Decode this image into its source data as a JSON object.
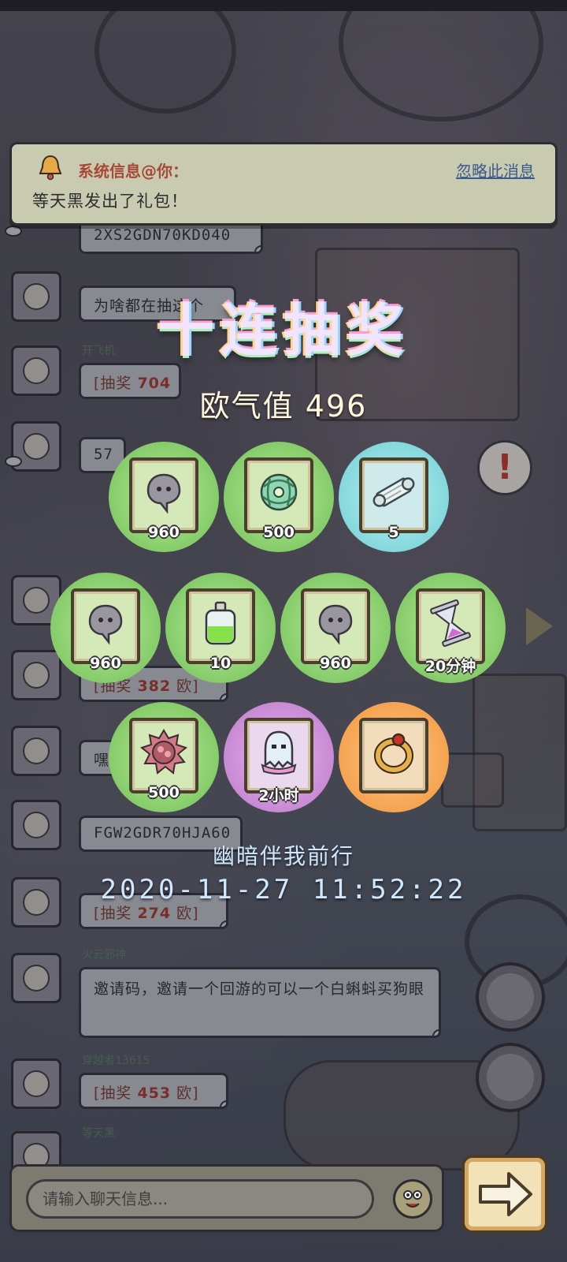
{
  "system_message": {
    "title": "系统信息@你：",
    "ignore_label": "忽略此消息",
    "body": "等天黑发出了礼包！"
  },
  "lottery": {
    "title": "十连抽奖",
    "luck_label": "欧气值",
    "luck_value": "496",
    "prizes": [
      {
        "quantity": "960",
        "rarity": "green",
        "icon": "ghost-blob-icon"
      },
      {
        "quantity": "500",
        "rarity": "green",
        "icon": "green-orb-icon"
      },
      {
        "quantity": "5",
        "rarity": "cyan",
        "icon": "scroll-icon"
      },
      {
        "quantity": "960",
        "rarity": "green",
        "icon": "ghost-blob-icon"
      },
      {
        "quantity": "10",
        "rarity": "green",
        "icon": "potion-bottle-icon"
      },
      {
        "quantity": "960",
        "rarity": "green",
        "icon": "ghost-blob-icon"
      },
      {
        "quantity": "20分钟",
        "rarity": "green",
        "icon": "hourglass-icon"
      },
      {
        "quantity": "500",
        "rarity": "green",
        "icon": "spiked-shell-icon"
      },
      {
        "quantity": "2小时",
        "rarity": "purple",
        "icon": "ghost-costume-icon"
      },
      {
        "quantity": "",
        "rarity": "orange",
        "icon": "gold-ring-icon"
      }
    ],
    "player_name": "幽暗伴我前行",
    "timestamp": "2020-11-27 11:52:22"
  },
  "chat": {
    "messages": [
      {
        "text": "2XS2GDN70KD040",
        "kind": "code"
      },
      {
        "text": "为啥都在抽这个",
        "kind": "text"
      },
      {
        "username": "开飞机",
        "lottery_prefix": "[抽奖 ",
        "amount": "704",
        "lottery_suffix": "",
        "kind": "lottery"
      },
      {
        "text": "57",
        "kind": "code"
      },
      {
        "lottery_prefix": "[抽奖 ",
        "amount": "382",
        "lottery_suffix": " 欧]",
        "kind": "lottery"
      },
      {
        "text": "嘿",
        "kind": "text"
      },
      {
        "text": "FGW2GDR70HJA60",
        "kind": "code"
      },
      {
        "lottery_prefix": "[抽奖 ",
        "amount": "274",
        "lottery_suffix": " 欧]",
        "kind": "lottery"
      },
      {
        "username": "火云邪神",
        "text": "邀请码，邀请一个回游的可以一个白蝌蚪买狗眼",
        "kind": "text"
      },
      {
        "username": "穿越者13615",
        "lottery_prefix": "[抽奖 ",
        "amount": "453",
        "lottery_suffix": " 欧]",
        "kind": "lottery"
      },
      {
        "username": "等天黑",
        "kind": "text"
      }
    ],
    "input_placeholder": "请输入聊天信息..."
  },
  "colors": {
    "prize_green": "#86cc6a",
    "prize_cyan": "#84d8dc",
    "prize_purple": "#c98ad4",
    "prize_orange": "#f5a450",
    "system_title": "#a84836",
    "ignore_link": "#3c5a8e"
  }
}
